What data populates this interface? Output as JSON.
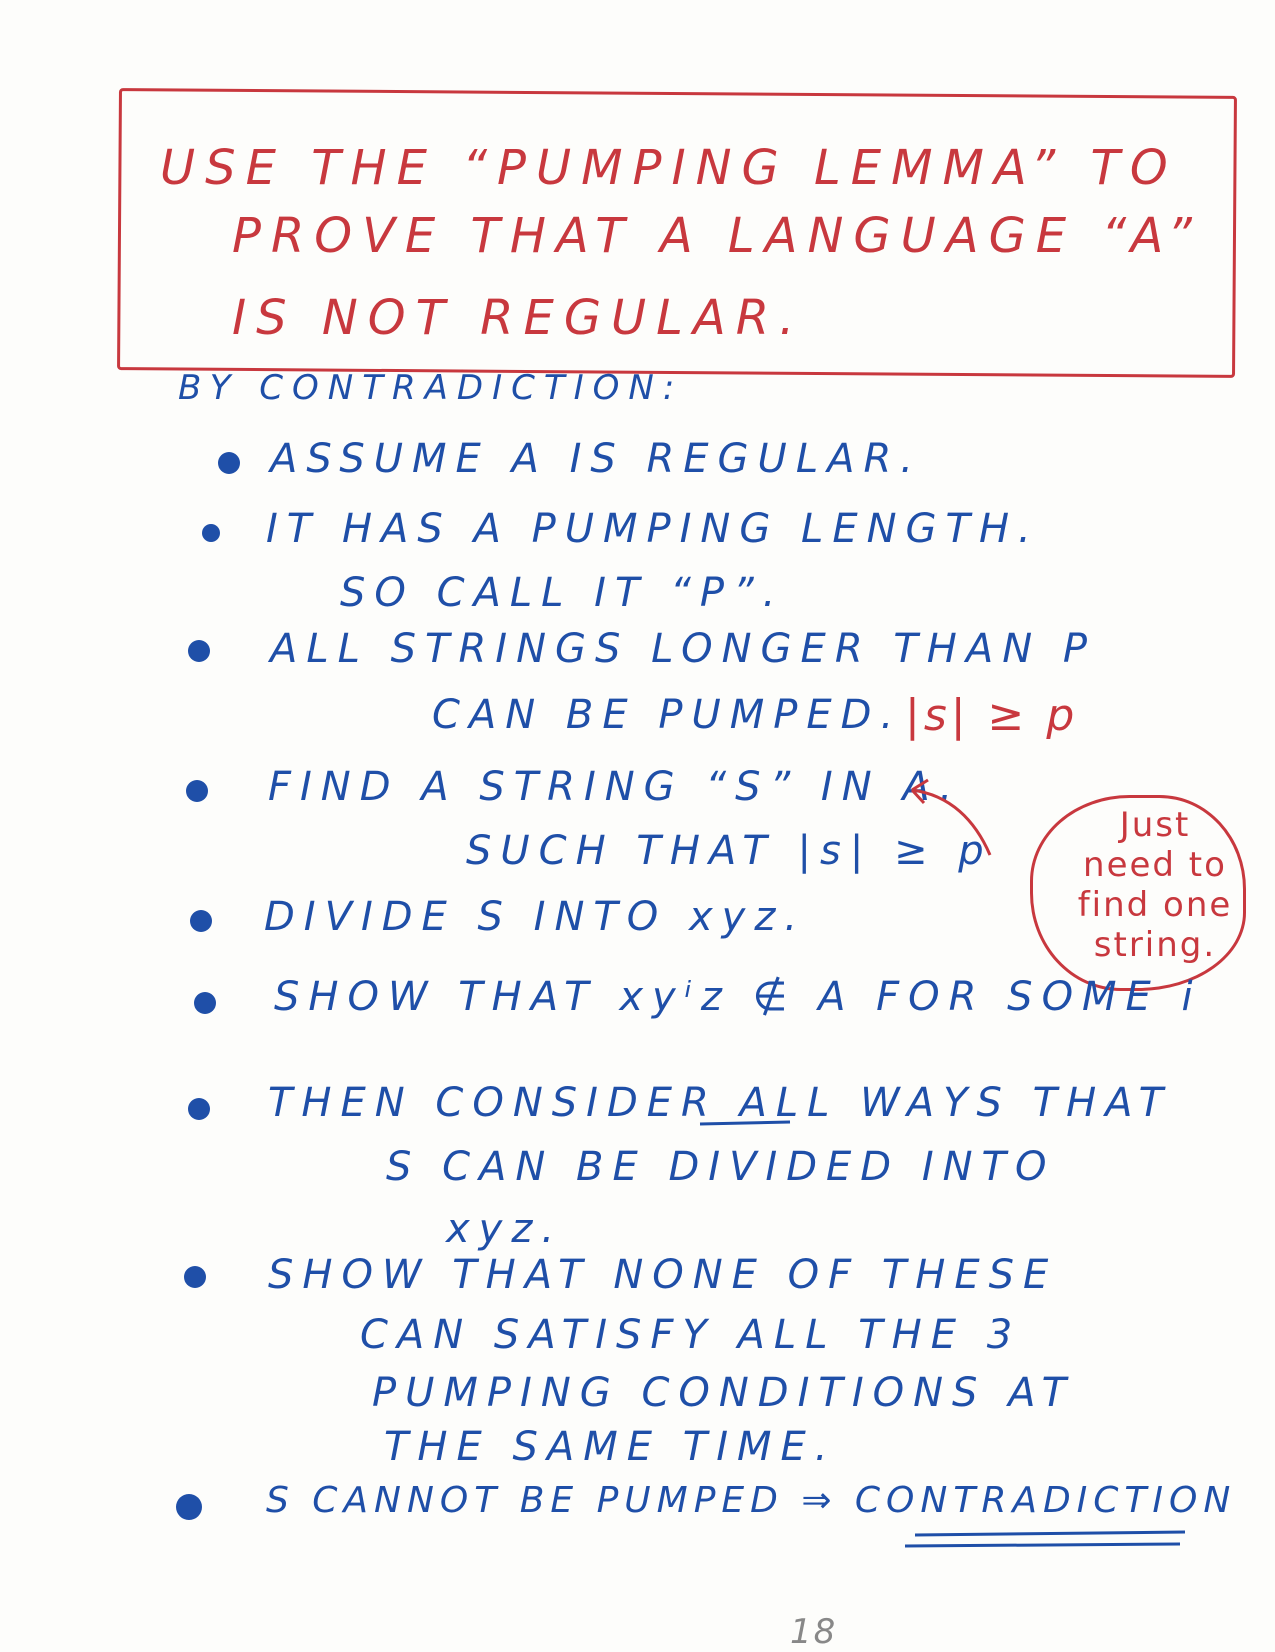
{
  "title": {
    "line1": "USE THE “PUMPING LEMMA” TO",
    "line2": "PROVE THAT A LANGUAGE “A”",
    "line3": "IS NOT REGULAR."
  },
  "intro": "BY CONTRADICTION:",
  "steps": [
    {
      "lines": [
        "ASSUME A IS REGULAR."
      ]
    },
    {
      "lines": [
        "IT HAS A PUMPING LENGTH.",
        "SO CALL IT “P”."
      ]
    },
    {
      "lines": [
        "ALL STRINGS LONGER THAN P",
        "CAN BE PUMPED."
      ],
      "note": "|s| ≥ p"
    },
    {
      "lines": [
        "FIND A STRING “S” IN A.",
        "SUCH THAT |s| ≥ p"
      ]
    },
    {
      "lines": [
        "DIVIDE S INTO xyz."
      ]
    },
    {
      "lines": [
        "SHOW THAT xyⁱz ∉ A FOR SOME i"
      ]
    },
    {
      "lines": [
        "THEN CONSIDER ALL WAYS THAT",
        "S CAN BE DIVIDED INTO",
        "xyz."
      ]
    },
    {
      "lines": [
        "SHOW THAT NONE OF THESE",
        "CAN SATISFY ALL THE 3",
        "PUMPING CONDITIONS AT",
        "THE SAME TIME."
      ]
    },
    {
      "lines": [
        "S CANNOT BE PUMPED ⇒ CONTRADICTION"
      ]
    }
  ],
  "side_note": "Just need to find one string.",
  "page_number": "18",
  "colors": {
    "red_ink": "#c8383e",
    "blue_ink": "#1f4fa8"
  }
}
